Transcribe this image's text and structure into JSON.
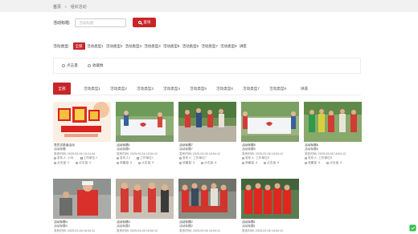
{
  "breadcrumb": {
    "home": "首页",
    "separator": "»",
    "current": "组织活动"
  },
  "search": {
    "label": "活动标题:",
    "placeholder": "活动标题",
    "button_label": "查询"
  },
  "filter": {
    "label": "活动类型:",
    "options": [
      "全部",
      "活动类型1",
      "活动类型2",
      "活动类型3",
      "活动类型4",
      "活动类型5",
      "活动类型6",
      "活动类型7",
      "活动类型8",
      "讲座"
    ]
  },
  "sort": {
    "options": [
      "点击量",
      "收藏数"
    ]
  },
  "tabs": [
    "全部",
    "活动类型1",
    "活动类型2",
    "活动类型3",
    "活动类型4",
    "活动类型5",
    "活动类型6",
    "活动类型7",
    "活动类型8",
    "讲座"
  ],
  "cards": [
    {
      "title": "党员志愿者活动",
      "subtitle": "活动标题",
      "time": "发布时间:  2025-03-06 19:24:04",
      "publisher": "发布人:  小月",
      "unit": "工作单位:1",
      "clicks": "点击量:  9",
      "favorites": "点击量:  5",
      "scene": "banner"
    },
    {
      "title": "活动标题1",
      "subtitle": "活动标题1",
      "time": "发布时间:  2025-03-06 18:54:12",
      "publisher": "发布人1",
      "unit": "工作单位1",
      "clicks": "收藏量:  6",
      "favorites": "点击量:  6",
      "scene": "flag"
    },
    {
      "title": "活动标题7",
      "subtitle": "活动标题7",
      "time": "发布时间:  2025-03-06 18:54:12",
      "publisher": "发布人:  工作单位7",
      "unit": "",
      "clicks": "收藏量:  8",
      "favorites": "点击量:  8",
      "scene": "park"
    },
    {
      "title": "活动标题5",
      "subtitle": "活动标题5",
      "time": "发布时间:  2025-03-06 18:54:12",
      "publisher": "发布人:  工作单位5",
      "unit": "",
      "clicks": "收藏量:  8",
      "favorites": "点击量:  6",
      "scene": "flag"
    },
    {
      "title": "活动标题8",
      "subtitle": "活动标题8",
      "time": "发布时间:  2025-03-06 18:54:12",
      "publisher": "发布人:  工作单位8",
      "unit": "",
      "clicks": "收藏量:  6",
      "favorites": "点击量:  6",
      "scene": "group"
    },
    {
      "title": "活动标题4",
      "subtitle": "活动标题4",
      "time": "发布时间:  2025-03-06 18:54:12",
      "publisher": "",
      "unit": "",
      "clicks": "",
      "favorites": "",
      "scene": "volunteer"
    },
    {
      "title": "活动标题3",
      "subtitle": "活动标题3",
      "time": "发布时间:  2025-03-06 18:54:12",
      "publisher": "",
      "unit": "",
      "clicks": "",
      "favorites": "",
      "scene": "street"
    },
    {
      "title": "活动标题2",
      "subtitle": "活动标题2",
      "time": "发布时间:  2025-03-06 18:54:12",
      "publisher": "",
      "unit": "",
      "clicks": "",
      "favorites": "",
      "scene": "crowd"
    },
    {
      "title": "活动标题1",
      "subtitle": "活动标题1",
      "time": "发布时间:  2025-03-06 18:54:12",
      "publisher": "",
      "unit": "",
      "clicks": "",
      "favorites": "",
      "scene": "red"
    }
  ],
  "colors": {
    "accent": "#c7252a",
    "breadcrumb_bg": "#f1f1f1",
    "border": "#ececec"
  },
  "icons": {
    "search": "search-icon",
    "app_corner": "app-icon"
  }
}
